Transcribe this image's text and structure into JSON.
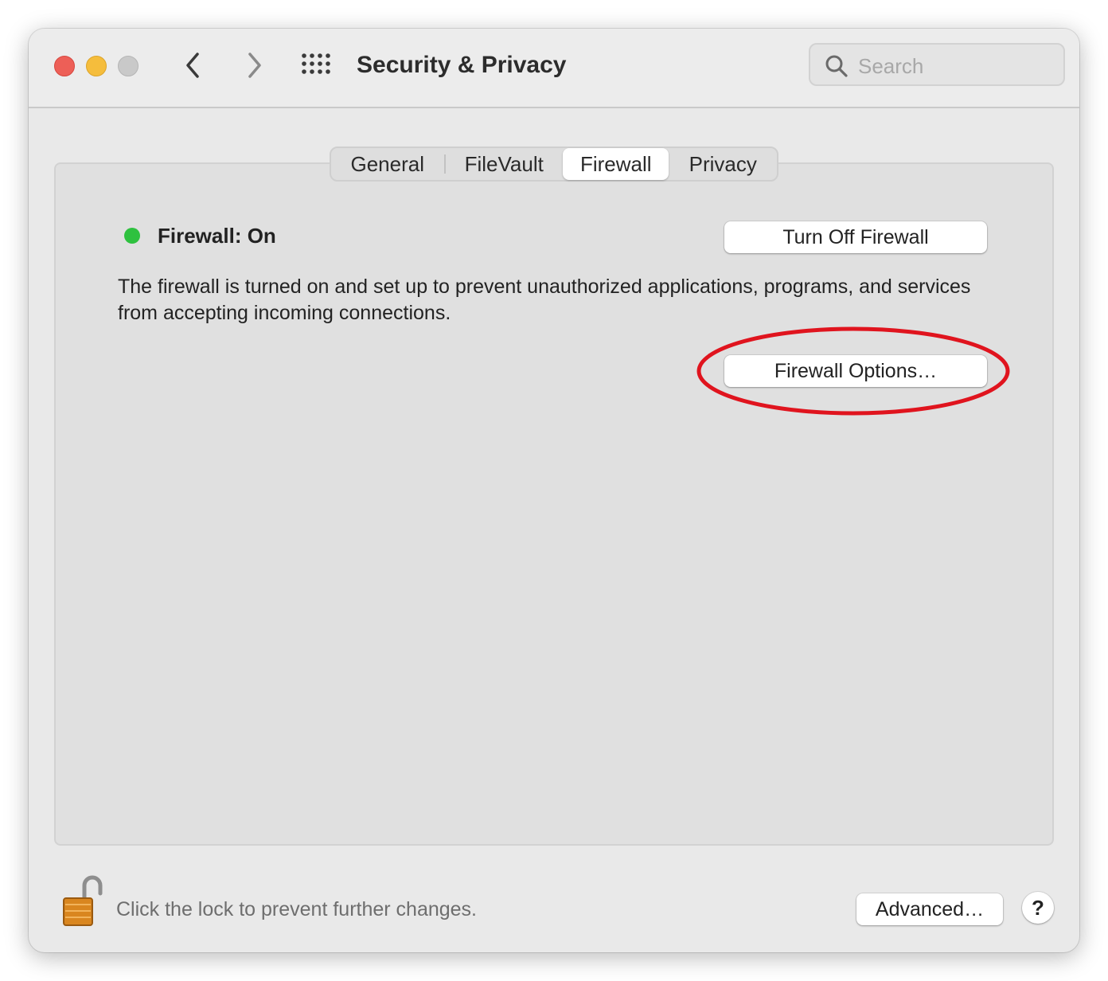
{
  "window": {
    "title": "Security & Privacy",
    "search_placeholder": "Search"
  },
  "tabs": [
    {
      "label": "General",
      "selected": false
    },
    {
      "label": "FileVault",
      "selected": false
    },
    {
      "label": "Firewall",
      "selected": true
    },
    {
      "label": "Privacy",
      "selected": false
    }
  ],
  "firewall": {
    "status_label": "Firewall: On",
    "status_color": "#2ec13f",
    "turn_off_label": "Turn Off Firewall",
    "description": "The firewall is turned on and set up to prevent unauthorized applications, programs, and services from accepting incoming connections.",
    "options_label": "Firewall Options…"
  },
  "annotation": {
    "color": "#e0141e",
    "target": "firewall-options-button"
  },
  "footer": {
    "lock_text": "Click the lock to prevent further changes.",
    "advanced_label": "Advanced…",
    "help_label": "?"
  },
  "icons": [
    "close-light",
    "minimize-light",
    "zoom-light",
    "back-chevron-icon",
    "forward-chevron-icon",
    "grid-icon",
    "search-icon",
    "unlocked-padlock-icon"
  ]
}
